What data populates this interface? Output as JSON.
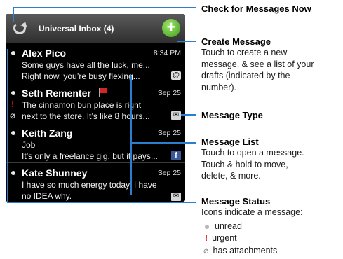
{
  "inbox": {
    "title": "Universal Inbox (4)"
  },
  "messages": [
    {
      "name": "Alex Pico",
      "time": "8:34 PM",
      "line1": "Some guys have all the luck, me...",
      "line2": "Right now, you’re busy flexing...",
      "icon": "at-icon"
    },
    {
      "name": "Seth Rementer",
      "time": "Sep 25",
      "line1": "The cinnamon bun place is right",
      "line2": "next to the store. It’s like 8 hours...",
      "icon": "envelope-icon"
    },
    {
      "name": "Keith Zang",
      "time": "Sep 25",
      "line1": "Job",
      "line2": "It’s only a freelance gig, but it pays...",
      "icon": "facebook-icon"
    },
    {
      "name": "Kate Shunney",
      "time": "Sep 25",
      "line1": "I have so much energy today. I have",
      "line2": "no IDEA why.",
      "icon": "envelope-icon"
    }
  ],
  "callouts": {
    "check": {
      "title": "Check for Messages Now"
    },
    "create": {
      "title": "Create Message",
      "desc": [
        "Touch to create a new",
        "message, & see a list of your",
        "drafts (indicated by the",
        "number)."
      ]
    },
    "type": {
      "title": "Message Type"
    },
    "list": {
      "title": "Message List",
      "desc": [
        "Touch to open a message.",
        "Touch & hold to move,",
        "delete, & more."
      ]
    },
    "status": {
      "title": "Message Status",
      "desc": [
        "Icons indicate a message:"
      ]
    }
  },
  "legend": [
    {
      "icon": "unread-dot-icon",
      "label": "unread"
    },
    {
      "icon": "urgent-icon",
      "label": "urgent"
    },
    {
      "icon": "attachment-icon",
      "label": "has attachments"
    }
  ],
  "colors": {
    "callout_line": "#2c7fd0",
    "compose": "#4caf24",
    "urgent": "#e02020"
  }
}
